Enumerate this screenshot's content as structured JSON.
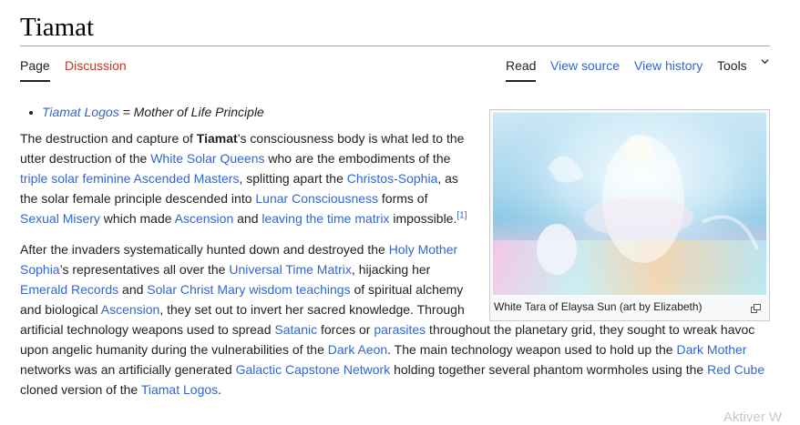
{
  "page": {
    "title": "Tiamat"
  },
  "tabs": {
    "page": "Page",
    "discussion": "Discussion",
    "read": "Read",
    "view_source": "View source",
    "view_history": "View history",
    "tools": "Tools"
  },
  "bullet": {
    "link": "Tiamat Logos",
    "text": " = Mother of Life Principle"
  },
  "para1": {
    "t1": "The destruction and capture of ",
    "b1": "Tiamat",
    "t2": "’s consciousness body is what led to the utter destruction of the ",
    "l1": "White Solar Queens",
    "t3": " who are the embodiments of the ",
    "l2": "triple solar feminine Ascended Masters",
    "t4": ", splitting apart the ",
    "l3": "Christos-Sophia",
    "t5": ", as the solar female principle descended into ",
    "l4": "Lunar Consciousness",
    "t6": " forms of ",
    "l5": "Sexual Misery",
    "t7": " which made ",
    "l6": "Ascension",
    "t8": " and ",
    "l7": "leaving the time matrix",
    "t9": " impossible.",
    "ref": "[1]"
  },
  "para2": {
    "t1": "After the invaders systematically hunted down and destroyed the ",
    "l1": "Holy Mother Sophia",
    "t2": "’s representatives all over the ",
    "l2": "Universal Time Matrix",
    "t3": ", hijacking her ",
    "l3": "Emerald Records",
    "t4": " and ",
    "l4": "Solar Christ Mary wisdom teachings",
    "t5": " of spiritual alchemy and biological ",
    "l5": "Ascension",
    "t6": ", they set out to invert her sacred knowledge. Through artificial technology weapons used to spread ",
    "l6": "Satanic",
    "t7": " forces or ",
    "l7": "parasites",
    "t8": " throughout the planetary grid, they sought to wreak havoc upon angelic humanity during the vulnerabilities of the ",
    "l8": "Dark Aeon",
    "t9": ". The main technology weapon used to hold up the ",
    "l9": "Dark Mother",
    "t10": " networks was an artificially generated ",
    "l10": "Galactic Capstone Network",
    "t11": " holding together several phantom wormholes using the ",
    "l11": "Red Cube",
    "t12": " cloned version of the ",
    "l12": "Tiamat Logos",
    "t13": "."
  },
  "thumb": {
    "caption": "White Tara of Elaysa Sun (art by Elizabeth)",
    "expand_icon": "expand-icon"
  },
  "overlay": {
    "watermark": "Aktiver W"
  },
  "colors": {
    "link": "#3366cc",
    "discussion_link": "#ba3a22",
    "text": "#202122",
    "rule": "#a2a9b1"
  },
  "icons": {
    "tools_menu": "chevron-down-icon"
  }
}
